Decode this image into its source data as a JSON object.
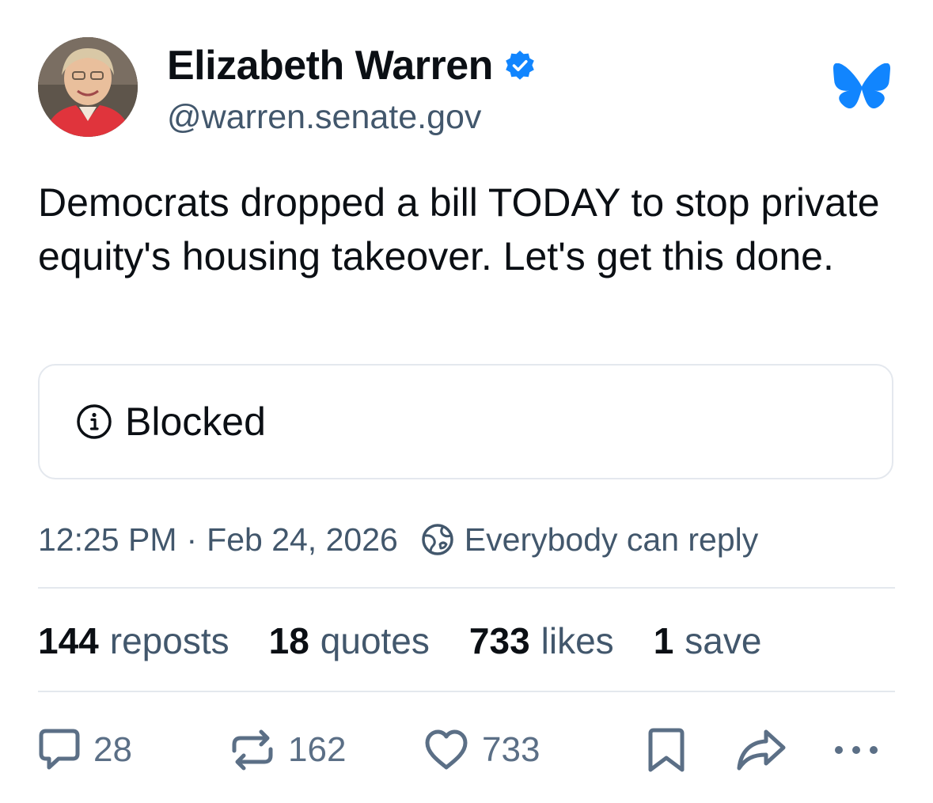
{
  "author": {
    "name": "Elizabeth Warren",
    "handle": "@warren.senate.gov",
    "verified": true
  },
  "post": {
    "text": "Democrats dropped a bill TODAY to stop private equity's housing takeover. Let's get this done.",
    "embed": {
      "status_label": "Blocked",
      "icon": "info-icon"
    },
    "time": "12:25 PM",
    "separator": "·",
    "date": "Feb 24, 2026",
    "reply_setting": "Everybody can reply"
  },
  "stats": {
    "reposts_count": "144",
    "reposts_label": "reposts",
    "quotes_count": "18",
    "quotes_label": "quotes",
    "likes_count": "733",
    "likes_label": "likes",
    "saves_count": "1",
    "saves_label": "save"
  },
  "actions": {
    "reply_count": "28",
    "repost_count": "162",
    "like_count": "733",
    "icons": [
      "reply-icon",
      "repost-icon",
      "like-icon",
      "bookmark-icon",
      "share-icon",
      "more-icon"
    ]
  },
  "colors": {
    "brand": "#1185fe",
    "text_primary": "#0b0f14",
    "text_secondary": "#42576c",
    "icon_gray": "#5b6f86",
    "border": "#e4e8ee"
  }
}
